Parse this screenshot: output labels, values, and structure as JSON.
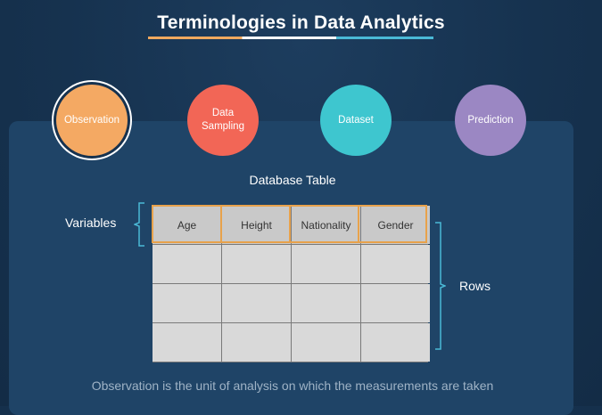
{
  "title": "Terminologies in Data Analytics",
  "concepts": [
    {
      "label": "Observation",
      "color": "#f4a963",
      "selected": true
    },
    {
      "label": "Data\nSampling",
      "color": "#f26656"
    },
    {
      "label": "Dataset",
      "color": "#3ec6cf"
    },
    {
      "label": "Prediction",
      "color": "#9b87c3"
    }
  ],
  "table": {
    "title": "Database Table",
    "headers": [
      "Age",
      "Height",
      "Nationality",
      "Gender"
    ],
    "rows": [
      [
        "",
        "",
        "",
        ""
      ],
      [
        "",
        "",
        "",
        ""
      ],
      [
        "",
        "",
        "",
        ""
      ]
    ]
  },
  "labels": {
    "variables": "Variables",
    "rows": "Rows"
  },
  "caption": "Observation is the unit of analysis on which the measurements are taken"
}
